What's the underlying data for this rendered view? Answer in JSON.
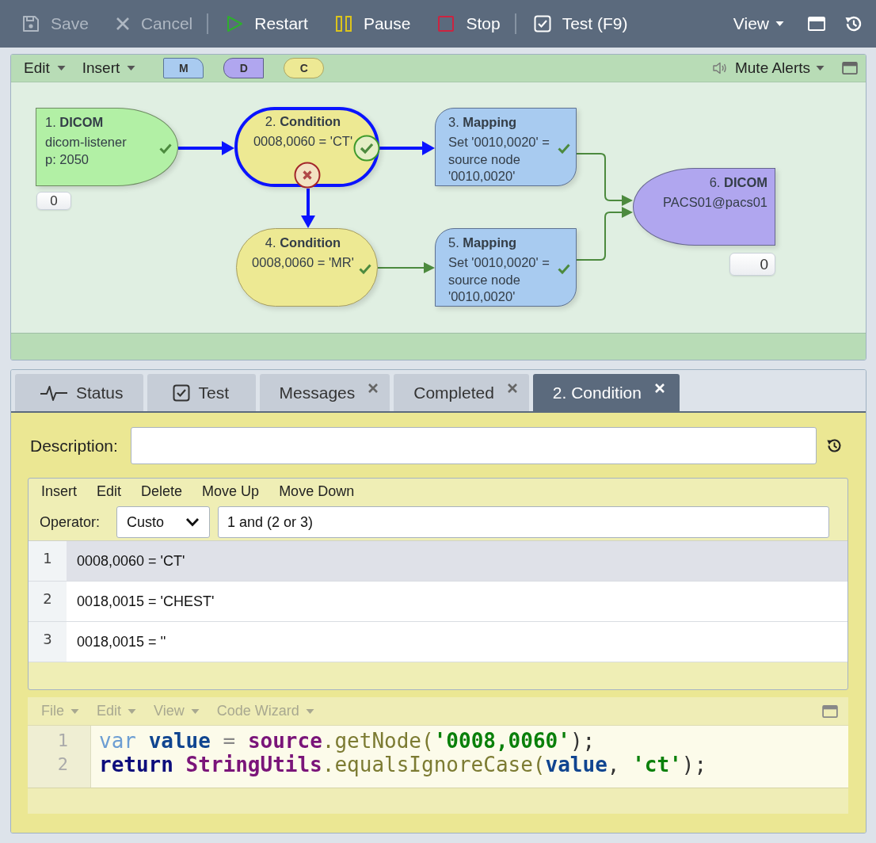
{
  "toolbar": {
    "button_groups": [
      [
        {
          "kind": "save",
          "label": "Save",
          "disabled": true
        },
        {
          "kind": "cancel",
          "label": "Cancel",
          "disabled": true
        }
      ],
      [
        {
          "kind": "restart",
          "label": "Restart",
          "disabled": false
        },
        {
          "kind": "pause",
          "label": "Pause",
          "disabled": false
        },
        {
          "kind": "stop",
          "label": "Stop",
          "disabled": false
        }
      ],
      [
        {
          "kind": "test",
          "label": "Test (F9)",
          "disabled": false
        }
      ]
    ],
    "view_menu": {
      "label": "View"
    }
  },
  "diagram": {
    "menus": [
      {
        "label": "Edit"
      },
      {
        "label": "Insert"
      }
    ],
    "palette": [
      {
        "kind": "mapping",
        "label": "M"
      },
      {
        "kind": "destination",
        "label": "D"
      },
      {
        "kind": "condition",
        "label": "C"
      }
    ],
    "mute_alerts": "Mute Alerts",
    "nodes": [
      {
        "kind": "source",
        "title": "1. **DICOM**",
        "details": [
          "dicom-listener",
          "p: 2050"
        ],
        "checked": true,
        "selected": false,
        "counter": "0"
      },
      {
        "kind": "condition",
        "title": "2. **Condition**",
        "details": [
          "0008,0060 = 'CT'"
        ],
        "checked": true,
        "selected": true
      },
      {
        "kind": "mapping",
        "title": "3. **Mapping**",
        "details": [
          "Set '0010,0020' = source node '0010,0020'"
        ],
        "checked": true,
        "selected": false
      },
      {
        "kind": "condition",
        "title": "4. **Condition**",
        "details": [
          "0008,0060 = 'MR'"
        ],
        "checked": true,
        "selected": false
      },
      {
        "kind": "mapping",
        "title": "5. **Mapping**",
        "details": [
          "Set '0010,0020' = source node '0010,0020'"
        ],
        "checked": true,
        "selected": false
      },
      {
        "kind": "destination",
        "title": "6. **DICOM**",
        "details": [
          "PACS01@pacs01"
        ],
        "checked": false,
        "selected": false,
        "counter": "0"
      }
    ]
  },
  "tabs": [
    {
      "kind": "status",
      "label": "Status",
      "closable": false,
      "selected": false
    },
    {
      "kind": "test",
      "label": "Test",
      "closable": false,
      "selected": false
    },
    {
      "kind": "document",
      "label": "Messages",
      "closable": true,
      "selected": false
    },
    {
      "kind": "document",
      "label": "Completed",
      "closable": true,
      "selected": false
    },
    {
      "kind": "document",
      "label": "2. Condition",
      "closable": true,
      "selected": true
    }
  ],
  "condition_editor": {
    "description_label": "Description:",
    "list_toolbar": [
      "Insert",
      "Edit",
      "Delete",
      "Move Up",
      "Move Down"
    ],
    "operator": {
      "label": "Operator:",
      "value": "Custo",
      "expression": "1 and (2 or 3)"
    },
    "rows": [
      {
        "number": "1",
        "text": "0008,0060 = 'CT'",
        "selected": true
      },
      {
        "number": "2",
        "text": "0018,0015 = 'CHEST'",
        "selected": false
      },
      {
        "number": "3",
        "text": "0018,0015 = ''",
        "selected": false
      }
    ]
  },
  "code_editor": {
    "menus": [
      {
        "label": "File",
        "disabled": true
      },
      {
        "label": "Edit",
        "disabled": true
      },
      {
        "label": "View",
        "disabled": true
      },
      {
        "label": "Code Wizard",
        "disabled": true
      }
    ],
    "lines": [
      {
        "number": "1",
        "tokens": [
          {
            "kind": "declaration",
            "text": "var "
          },
          {
            "kind": "variable",
            "text": "value"
          },
          {
            "kind": "operator",
            "text": " = "
          },
          {
            "kind": "object",
            "text": "source"
          },
          {
            "kind": "method",
            "text": ".getNode("
          },
          {
            "kind": "string",
            "text": "'0008,0060'"
          },
          {
            "kind": "punctuation",
            "text": ");"
          }
        ]
      },
      {
        "number": "2",
        "tokens": [
          {
            "kind": "keyword",
            "text": "return "
          },
          {
            "kind": "object",
            "text": "StringUtils"
          },
          {
            "kind": "method",
            "text": ".equalsIgnoreCase("
          },
          {
            "kind": "variable",
            "text": "value"
          },
          {
            "kind": "punctuation",
            "text": ", "
          },
          {
            "kind": "string",
            "text": "'ct'"
          },
          {
            "kind": "punctuation",
            "text": ");"
          }
        ]
      }
    ]
  }
}
